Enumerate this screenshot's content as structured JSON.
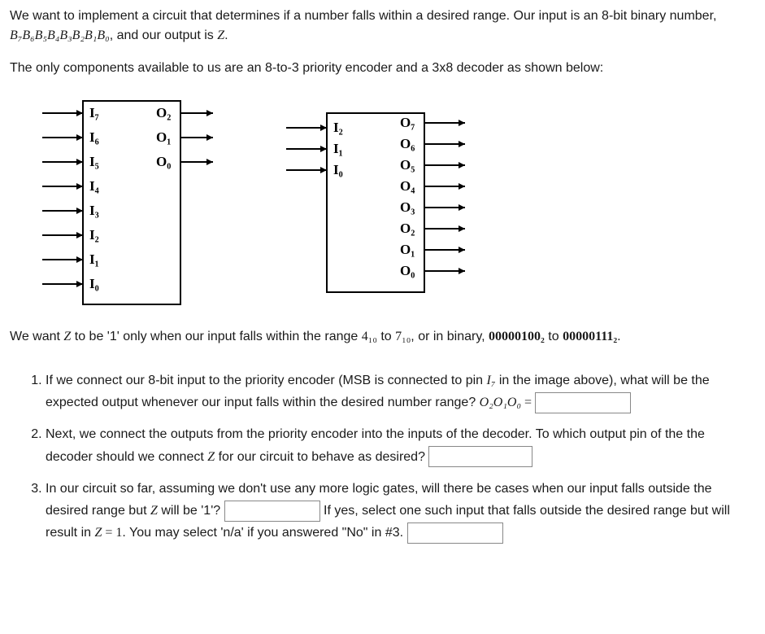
{
  "intro": {
    "p1_a": "We want to implement a circuit that determines if a number falls within a desired range. Our input is an 8-bit binary number, ",
    "bits": "B₇B₆B₅B₄B₃B₂B₁B₀",
    "p1_b": ", and our output is ",
    "zvar": "Z",
    "p1_c": ".",
    "p2": "The only components available to us are an 8-to-3 priority encoder and a 3x8 decoder as shown below:"
  },
  "encoder": {
    "inputs": [
      "I₇",
      "I₆",
      "I₅",
      "I₄",
      "I₃",
      "I₂",
      "I₁",
      "I₀"
    ],
    "outputs": [
      "O₂",
      "O₁",
      "O₀"
    ]
  },
  "decoder": {
    "inputs": [
      "I₂",
      "I₁",
      "I₀"
    ],
    "outputs": [
      "O₇",
      "O₆",
      "O₅",
      "O₄",
      "O₃",
      "O₂",
      "O₁",
      "O₀"
    ]
  },
  "range_text": {
    "a": "We want ",
    "z": "Z",
    "b": " to be '1' only when our input falls within the range ",
    "r1": "4₁₀",
    "c": " to ",
    "r2": "7₁₀",
    "d": ", or in binary, ",
    "b1": "00000100₂",
    "e": " to ",
    "b2": "00000111₂",
    "f": "."
  },
  "q1": {
    "a": "If we connect our 8-bit input to the priority encoder (MSB is connected to pin ",
    "i7": "I₇",
    "b": " in the image above), what will be the expected output  whenever our input falls within the desired number range? ",
    "out": "O₂O₁O₀",
    "eq": " = "
  },
  "q2": {
    "a": "Next, we connect the outputs from the priority encoder into the inputs of the decoder. To which output pin of the the decoder should we connect ",
    "z": "Z",
    "b": " for our circuit to behave as desired? "
  },
  "q3": {
    "a": "In our circuit so far, assuming we don't use any more logic gates, will there be cases when our input falls outside the desired range but ",
    "z": "Z",
    "b": " will be '1'? ",
    "c": " If yes, select one such input that falls outside the desired range but will result in ",
    "z2": "Z",
    "eq": " = 1",
    "d": ". You may select 'n/a' if you answered \"No\" in #3. "
  }
}
